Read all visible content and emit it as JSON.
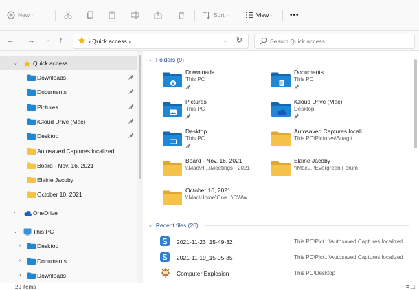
{
  "toolbar": {
    "new_label": "New",
    "sort_label": "Sort",
    "view_label": "View",
    "more_label": "•••"
  },
  "navbar": {
    "breadcrumb": "Quick access",
    "breadcrumb_sep": "›",
    "search_placeholder": "Search Quick access"
  },
  "sidebar": {
    "quick_access": "Quick access",
    "quick_items": [
      {
        "label": "Downloads",
        "icon": "downloads-folder-icon",
        "pinned": true
      },
      {
        "label": "Documents",
        "icon": "documents-folder-icon",
        "pinned": true
      },
      {
        "label": "Pictures",
        "icon": "pictures-folder-icon",
        "pinned": true
      },
      {
        "label": "iCloud Drive (Mac)",
        "icon": "icloud-folder-icon",
        "pinned": true
      },
      {
        "label": "Desktop",
        "icon": "desktop-folder-icon",
        "pinned": true
      },
      {
        "label": "Autosaved Captures.localized",
        "icon": "folder-icon",
        "pinned": false
      },
      {
        "label": "Board - Nov. 16, 2021",
        "icon": "folder-icon",
        "pinned": false
      },
      {
        "label": "Elaine Jacoby",
        "icon": "folder-icon",
        "pinned": false
      },
      {
        "label": "October 10, 2021",
        "icon": "folder-icon",
        "pinned": false
      }
    ],
    "onedrive": "OneDrive",
    "this_pc": "This PC",
    "pc_items": [
      {
        "label": "Desktop"
      },
      {
        "label": "Documents"
      },
      {
        "label": "Downloads"
      }
    ]
  },
  "folders": {
    "title": "Folders (9)",
    "items": [
      {
        "name": "Downloads",
        "sub": "This PC",
        "pinned": true,
        "kind": "downloads"
      },
      {
        "name": "Documents",
        "sub": "This PC",
        "pinned": true,
        "kind": "documents"
      },
      {
        "name": "Pictures",
        "sub": "This PC",
        "pinned": true,
        "kind": "pictures"
      },
      {
        "name": "iCloud Drive (Mac)",
        "sub": "Desktop",
        "pinned": true,
        "kind": "icloud"
      },
      {
        "name": "Desktop",
        "sub": "This PC",
        "pinned": true,
        "kind": "desktop"
      },
      {
        "name": "Autosaved Captures.locali...",
        "sub": "This PC\\Pictures\\Snagit",
        "pinned": false,
        "kind": "yellow"
      },
      {
        "name": "Board - Nov. 16, 2021",
        "sub": "\\\\Mac\\H...\\Meetings - 2021",
        "pinned": false,
        "kind": "yellow"
      },
      {
        "name": "Elaine Jacoby",
        "sub": "\\\\Mac\\...\\Evergreen Forum",
        "pinned": false,
        "kind": "yellow"
      },
      {
        "name": "October 10, 2021",
        "sub": "\\\\Mac\\Home\\One...\\CWW",
        "pinned": false,
        "kind": "yellow"
      }
    ]
  },
  "recent": {
    "title": "Recent files (20)",
    "items": [
      {
        "name": "2021-11-23_15-49-32",
        "path": "This PC\\Pict...\\Autosaved Captures.localized",
        "icon": "snagit-file-icon"
      },
      {
        "name": "2021-11-19_15-05-35",
        "path": "This PC\\Pict...\\Autosaved Captures.localized",
        "icon": "snagit-file-icon"
      },
      {
        "name": "Computer Explosion",
        "path": "This PC\\Desktop",
        "icon": "image-file-icon"
      }
    ]
  },
  "status": {
    "count": "29 items"
  },
  "colors": {
    "folder_blue": "#1e88d6",
    "folder_yellow": "#f5c24a",
    "accent": "#2a4d8f"
  }
}
